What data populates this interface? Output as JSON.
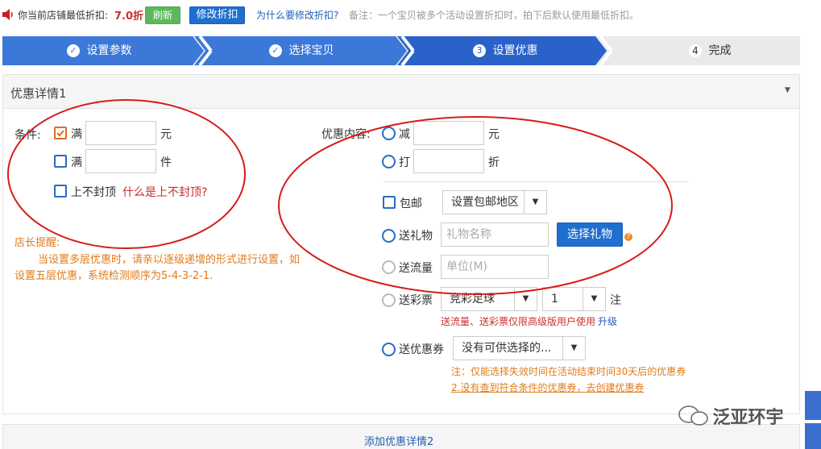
{
  "topbar": {
    "prefix": "你当前店铺最低折扣:",
    "discount": "7.0折",
    "refresh_label": "刷新",
    "modify_label": "修改折扣",
    "why_link": "为什么要修改折扣?",
    "note": "备注：一个宝贝被多个活动设置折扣时，拍下后默认使用最低折扣。"
  },
  "steps": [
    {
      "label": "设置参数",
      "marker": "✓"
    },
    {
      "label": "选择宝贝",
      "marker": "✓"
    },
    {
      "label": "设置优惠",
      "marker": "3"
    },
    {
      "label": "完成",
      "marker": "4"
    }
  ],
  "panel": {
    "title": "优惠详情1"
  },
  "conditions": {
    "label": "条件:",
    "man1": "满",
    "unit_yuan": "元",
    "man2": "满",
    "unit_jian": "件",
    "no_cap": "上不封顶",
    "no_cap_link": "什么是上不封顶?"
  },
  "tip": {
    "title": "店长提醒:",
    "line1": "当设置多层优惠时，请亲以逐级递增的形式进行设置，如",
    "line2": "设置五层优惠，系统检测顺序为5-4-3-2-1."
  },
  "offer": {
    "label": "优惠内容:",
    "reduce": "减",
    "reduce_unit": "元",
    "discount": "打",
    "discount_unit": "折",
    "free_ship": "包邮",
    "ship_region": "设置包邮地区",
    "gift": "送礼物",
    "gift_placeholder": "礼物名称",
    "gift_button": "选择礼物",
    "data": "送流量",
    "data_placeholder": "单位(M)",
    "lottery": "送彩票",
    "lottery_type": "竞彩足球",
    "lottery_count": "1",
    "lottery_unit": "注",
    "lottery_note": "送流量、送彩票仅限高级版用户使用",
    "upgrade": "升级",
    "coupon": "送优惠券",
    "coupon_select": "没有可供选择的...",
    "coupon_note1": "注：仅能选择失效时间在活动结束时间30天后的优惠券",
    "coupon_note2": "2.没有查到符合条件的优惠券，去创建优惠券"
  },
  "footer": {
    "add_label": "添加优惠详情2"
  },
  "watermark": "泛亚环宇",
  "colors": {
    "step_active": "#2a62c9",
    "step_done": "#3b78d8",
    "accent_red": "#d61b1b"
  }
}
